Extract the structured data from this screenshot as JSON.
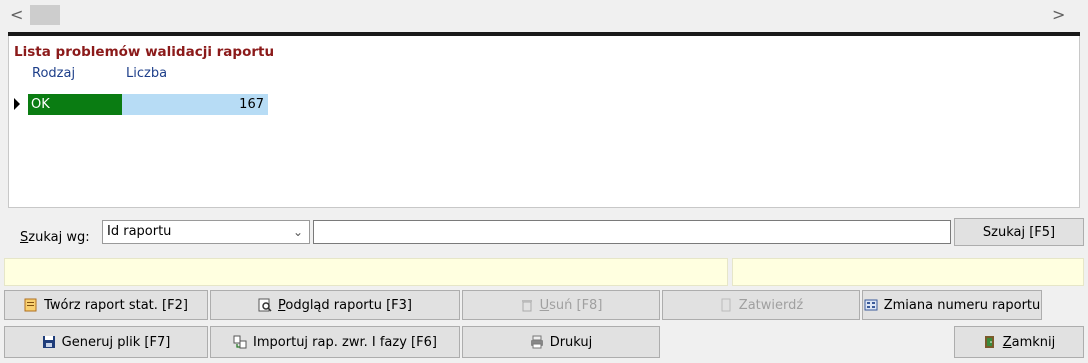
{
  "scrollbar": {
    "left_arrow": "<",
    "right_arrow": ">"
  },
  "panel": {
    "title": "Lista problemów walidacji raportu",
    "columns": [
      "Rodzaj",
      "Liczba"
    ],
    "rows": [
      {
        "rodzaj": "OK",
        "liczba": "167"
      }
    ]
  },
  "search": {
    "label_prefix": "S",
    "label_rest": "zukaj wg:",
    "select_value": "Id raportu",
    "input_value": "",
    "button_label": "Szukaj [F5]"
  },
  "toolbar": {
    "create_stat_report": "Twórz raport stat. [F2]",
    "preview_report_prefix": "P",
    "preview_report_rest": "odgląd raportu [F3]",
    "delete_prefix": "U",
    "delete_rest": "suń [F8]",
    "approve": "Zatwierdź",
    "change_report_number": "Zmiana numeru raportu",
    "generate_file": "Generuj plik [F7]",
    "import_reports": "Importuj rap. zwr. I fazy [F6]",
    "print": "Drukuj",
    "close_prefix": "Z",
    "close_rest": "amknij"
  },
  "colors": {
    "title": "#8b1a1a",
    "ok_row": "#0a7c12",
    "value_cell": "#b7dcf5",
    "status_bar": "#ffffe0"
  }
}
